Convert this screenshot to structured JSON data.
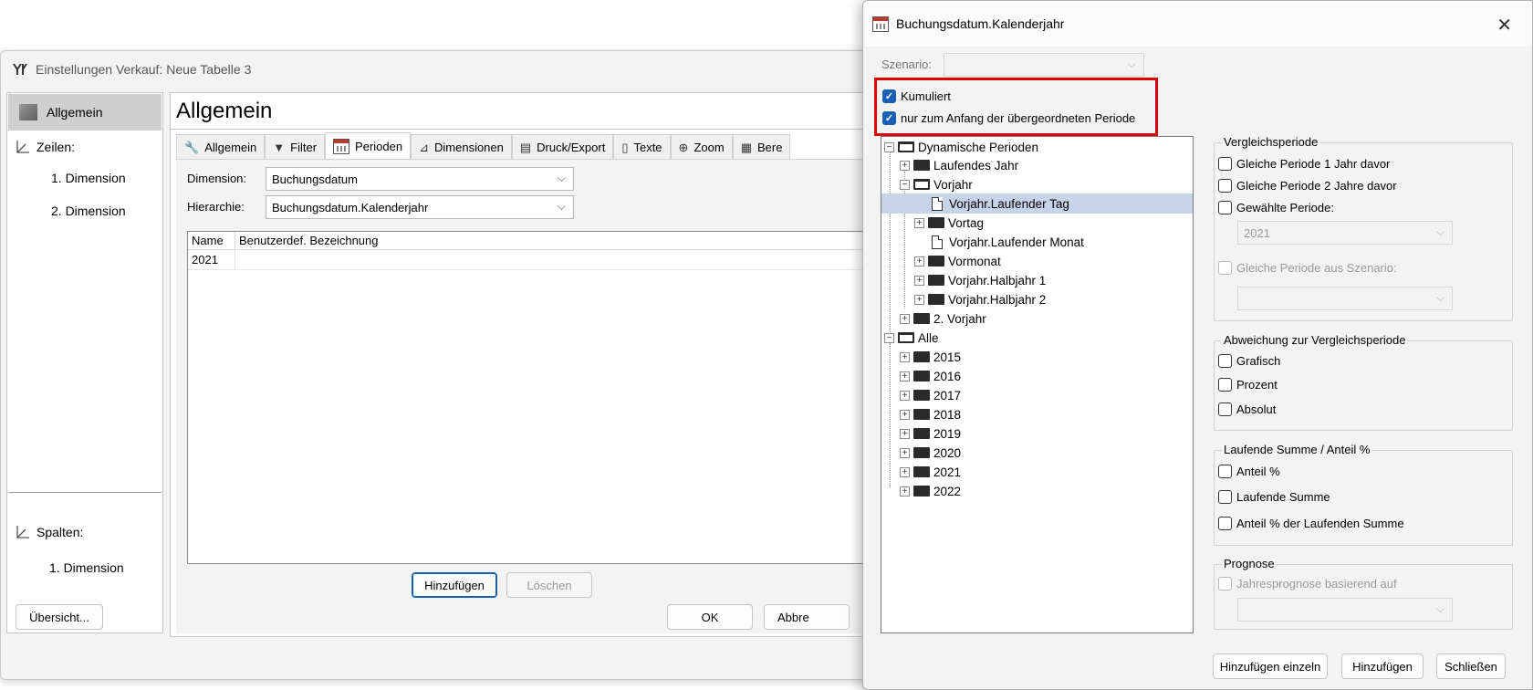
{
  "back_window": {
    "title": "Einstellungen Verkauf: Neue Tabelle 3",
    "nav": {
      "selected": "Allgemein",
      "rows_header": "Zeilen:",
      "rows_items": [
        "1. Dimension",
        "2. Dimension"
      ],
      "cols_header": "Spalten:",
      "cols_items": [
        "1. Dimension"
      ]
    },
    "page_title": "Allgemein",
    "tabs": [
      {
        "label": "Allgemein",
        "icon": "wrench-icon"
      },
      {
        "label": "Filter",
        "icon": "filter-icon"
      },
      {
        "label": "Perioden",
        "icon": "calendar-icon"
      },
      {
        "label": "Dimensionen",
        "icon": "dimensions-icon"
      },
      {
        "label": "Druck/Export",
        "icon": "printer-icon"
      },
      {
        "label": "Texte",
        "icon": "text-icon"
      },
      {
        "label": "Zoom",
        "icon": "zoom-icon"
      },
      {
        "label": "Bere",
        "icon": "calc-icon"
      }
    ],
    "active_tab": "Perioden",
    "dimension_label": "Dimension:",
    "dimension_value": "Buchungsdatum",
    "hierarchy_label": "Hierarchie:",
    "hierarchy_value": "Buchungsdatum.Kalenderjahr",
    "table": {
      "columns": [
        "Name",
        "Benutzerdef. Bezeichnung"
      ],
      "rows": [
        [
          "2021",
          ""
        ]
      ]
    },
    "add_button": "Hinzufügen",
    "delete_button": "Löschen",
    "overview_button": "Übersicht...",
    "ok_button": "OK",
    "cancel_button": "Abbre"
  },
  "dialog": {
    "title": "Buchungsdatum.Kalenderjahr",
    "scenario_label": "Szenario:",
    "scenario_value": "",
    "kumuliert_label": "Kumuliert",
    "kumuliert_checked": true,
    "anfang_label": "nur zum Anfang der übergeordneten Periode",
    "anfang_checked": true,
    "tree": {
      "dynamic": "Dynamische Perioden",
      "laufendes_jahr": "Laufendes Jahr",
      "vorjahr": "Vorjahr",
      "vorjahr_laufender_tag": "Vorjahr.Laufender Tag",
      "vortag": "Vortag",
      "vorjahr_laufender_monat": "Vorjahr.Laufender Monat",
      "vormonat": "Vormonat",
      "vorjahr_halbjahr_1": "Vorjahr.Halbjahr 1",
      "vorjahr_halbjahr_2": "Vorjahr.Halbjahr 2",
      "zweites_vorjahr": "2. Vorjahr",
      "alle": "Alle",
      "years": [
        "2015",
        "2016",
        "2017",
        "2018",
        "2019",
        "2020",
        "2021",
        "2022"
      ]
    },
    "vergleich": {
      "title": "Vergleichsperiode",
      "opt1": "Gleiche Periode 1 Jahr davor",
      "opt2": "Gleiche Periode 2 Jahre davor",
      "opt3": "Gewählte Periode:",
      "period_value": "2021",
      "opt4": "Gleiche Periode aus Szenario:"
    },
    "abweichung": {
      "title": "Abweichung zur Vergleichsperiode",
      "opt1": "Grafisch",
      "opt2": "Prozent",
      "opt3": "Absolut"
    },
    "laufende": {
      "title": "Laufende Summe / Anteil %",
      "opt1": "Anteil %",
      "opt2": "Laufende Summe",
      "opt3": "Anteil % der Laufenden Summe"
    },
    "prognose": {
      "title": "Prognose",
      "opt1": "Jahresprognose basierend auf"
    },
    "add_single_button": "Hinzufügen einzeln",
    "add_button": "Hinzufügen",
    "close_button": "Schließen",
    "highlight_color": "#e00000",
    "accent_color": "#1a5fb4"
  }
}
